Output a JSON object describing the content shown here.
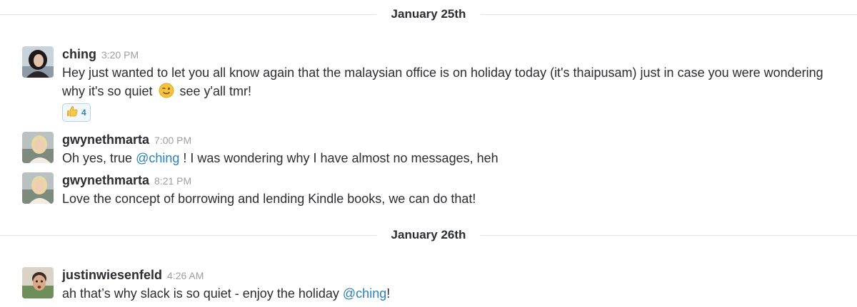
{
  "days": [
    {
      "date_label": "January 25th",
      "messages": [
        {
          "author": "ching",
          "time": "3:20 PM",
          "text_part1": "Hey just wanted to let you all know again that the malaysian office is on holiday today (it's thaipusam) just in case you were wondering why it's so quiet",
          "emoji": "winking-face-icon",
          "text_part2": "see y'all tmr!",
          "reaction": {
            "emoji": "thumbs-up-icon",
            "count": "4"
          }
        },
        {
          "author": "gwynethmarta",
          "time": "7:00 PM",
          "text_before": "Oh yes, true",
          "mention": "@ching",
          "text_after": "! I was wondering why I have almost no messages, heh"
        },
        {
          "author": "gwynethmarta",
          "time": "8:21 PM",
          "text": "Love the concept of borrowing and lending Kindle books, we can do that!"
        }
      ]
    },
    {
      "date_label": "January 26th",
      "messages": [
        {
          "author": "justinwiesenfeld",
          "time": "4:26 AM",
          "text_before": "ah that’s why slack is so quiet - enjoy the holiday",
          "mention": "@ching",
          "text_after": "!"
        }
      ]
    }
  ],
  "colors": {
    "mention": "#2a80b9",
    "timestamp": "#9e9ea6",
    "divider": "#e3e3e3",
    "reaction_border": "#b7d3e6"
  }
}
